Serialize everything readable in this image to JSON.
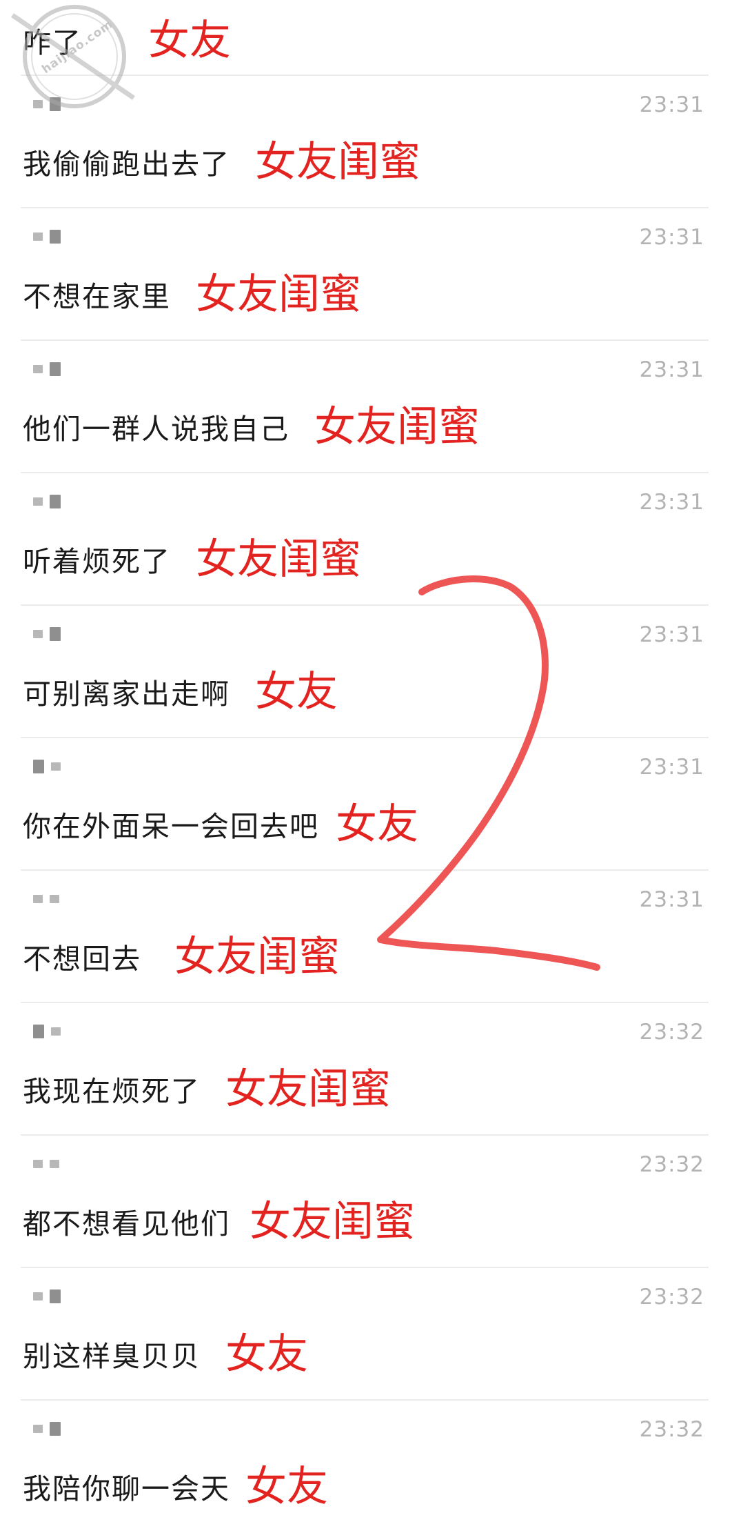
{
  "watermark": {
    "site": "haijiao.com"
  },
  "annotation": {
    "color": "#ee5656"
  },
  "colors": {
    "tag": "#e3231f",
    "time": "#b3b3b3",
    "message": "#1a1a1a"
  },
  "messages": [
    {
      "text": "咋了",
      "tag": "女友",
      "time": ""
    },
    {
      "text": "我偷偷跑出去了",
      "tag": "女友闺蜜",
      "time": "23:31"
    },
    {
      "text": "不想在家里",
      "tag": "女友闺蜜",
      "time": "23:31"
    },
    {
      "text": "他们一群人说我自己",
      "tag": "女友闺蜜",
      "time": "23:31"
    },
    {
      "text": "听着烦死了",
      "tag": "女友闺蜜",
      "time": "23:31"
    },
    {
      "text": "可别离家出走啊",
      "tag": "女友",
      "time": "23:31"
    },
    {
      "text": "你在外面呆一会回去吧",
      "tag": "女友",
      "time": "23:31"
    },
    {
      "text": "不想回去",
      "tag": "女友闺蜜",
      "time": "23:31"
    },
    {
      "text": "我现在烦死了",
      "tag": "女友闺蜜",
      "time": "23:32"
    },
    {
      "text": "都不想看见他们",
      "tag": "女友闺蜜",
      "time": "23:32"
    },
    {
      "text": "别这样臭贝贝",
      "tag": "女友",
      "time": "23:32"
    },
    {
      "text": "我陪你聊一会天",
      "tag": "女友",
      "time": "23:32"
    }
  ]
}
